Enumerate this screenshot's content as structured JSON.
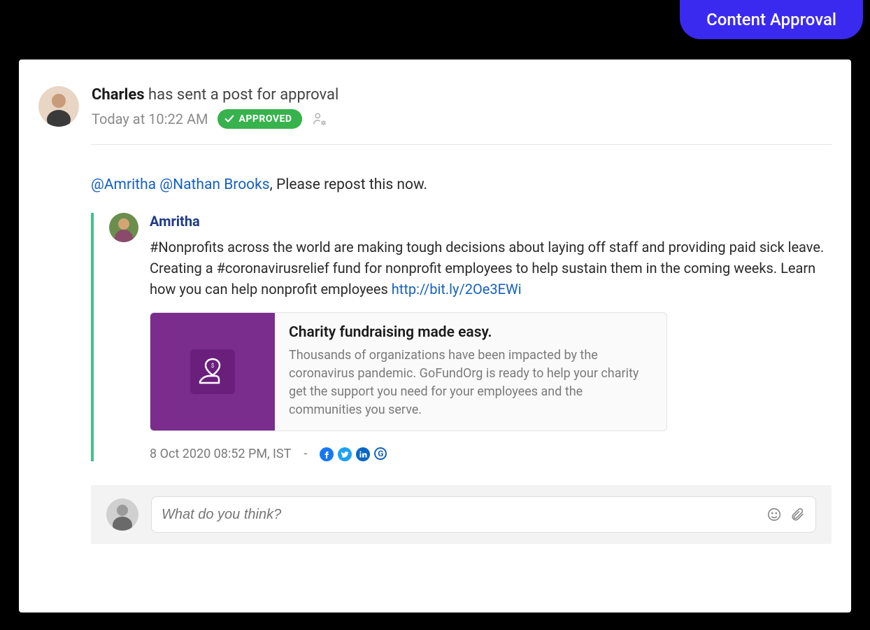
{
  "top_badge": "Content Approval",
  "header": {
    "author": "Charles",
    "action_suffix": "has sent a post for approval",
    "timestamp": "Today at 10:22 AM",
    "status_label": "APPROVED"
  },
  "request": {
    "mention1": "@Amritha",
    "mention2": "@Nathan Brooks",
    "rest": ", Please repost this now."
  },
  "quoted": {
    "author": "Amritha",
    "text_part1": "#Nonprofits across the world are making tough decisions about laying off staff and providing paid sick leave. Creating a #coronavirusrelief fund for nonprofit employees to help sustain them in the coming weeks. Learn how you can help nonprofit employees ",
    "link": "http://bit.ly/2Oe3EWi",
    "preview": {
      "title": "Charity fundraising made easy.",
      "desc": "Thousands of organizations have been impacted by the coronavirus pandemic. GoFundOrg is ready to help your charity get the support you need for your employees and the communities you serve."
    },
    "posted_at": "8 Oct 2020 08:52 PM, IST"
  },
  "comment": {
    "placeholder": "What do you think?"
  }
}
